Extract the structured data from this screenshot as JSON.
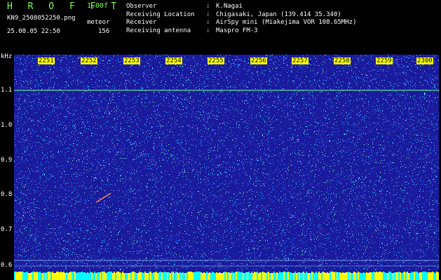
{
  "header": {
    "app_title": "H R O F F T",
    "version": "1.00f",
    "filename": "KN9_2508052250.png",
    "mode": "meteor",
    "timestamp": "25.08.05 22:50",
    "count": "156"
  },
  "meta": [
    {
      "key": "Observer",
      "value": "K.Nagai"
    },
    {
      "key": "Receiving Location",
      "value": "Chigasaki, Japan (139.414 35.340)"
    },
    {
      "key": "Receiver",
      "value": "AirSpy mini (Miakejima VOR 108.65MHz)"
    },
    {
      "key": "Receiving antenna",
      "value": "Maspro FM-3"
    }
  ],
  "plot": {
    "y_unit": "kHz",
    "y_ticks": [
      "1.1",
      "1.0",
      "0.9",
      "0.8",
      "0.7",
      "0.6"
    ],
    "x_ticks": [
      "2251",
      "2252",
      "2253",
      "2254",
      "2255",
      "2256",
      "2257",
      "2258",
      "2259",
      "2300"
    ],
    "colors": {
      "background": "#1a1a9c",
      "noise_low": "#2f6cff",
      "noise_mid": "#33c8ff",
      "noise_high": "#9cffc8",
      "carrier": "#5de08a",
      "strip_yellow": "#ffff00",
      "strip_cyan": "#00ffff"
    }
  }
}
